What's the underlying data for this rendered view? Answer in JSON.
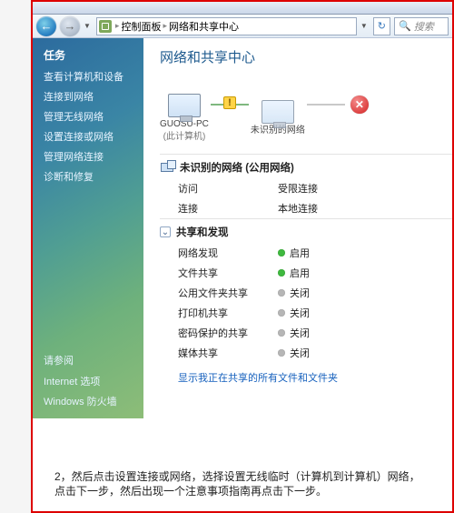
{
  "toolbar": {
    "breadcrumb": {
      "root": "控制面板",
      "page": "网络和共享中心"
    },
    "search_placeholder": "搜索"
  },
  "sidebar": {
    "title": "任务",
    "links": [
      "查看计算机和设备",
      "连接到网络",
      "管理无线网络",
      "设置连接或网络",
      "管理网络连接",
      "诊断和修复"
    ],
    "footer_title": "请参阅",
    "footer_links": [
      "Internet 选项",
      "Windows 防火墙"
    ]
  },
  "main": {
    "heading": "网络和共享中心",
    "diagram": {
      "pc_name": "GUOSU-PC",
      "pc_sub": "(此计算机)",
      "unknown_net": "未识别的网络"
    },
    "net_section": {
      "title": "未识别的网络 (公用网络)",
      "rows": [
        {
          "k": "访问",
          "v": "受限连接"
        },
        {
          "k": "连接",
          "v": "本地连接"
        }
      ]
    },
    "share_section": {
      "title": "共享和发现",
      "rows": [
        {
          "k": "网络发现",
          "v": "启用",
          "dot": "green"
        },
        {
          "k": "文件共享",
          "v": "启用",
          "dot": "green"
        },
        {
          "k": "公用文件夹共享",
          "v": "关闭",
          "dot": "grey"
        },
        {
          "k": "打印机共享",
          "v": "关闭",
          "dot": "grey"
        },
        {
          "k": "密码保护的共享",
          "v": "关闭",
          "dot": "grey"
        },
        {
          "k": "媒体共享",
          "v": "关闭",
          "dot": "grey"
        }
      ]
    },
    "bottom_link": "显示我正在共享的所有文件和文件夹"
  },
  "caption": "2，然后点击设置连接或网络，选择设置无线临时（计算机到计算机）网络，点击下一步，然后出现一个注意事项指南再点击下一步。"
}
